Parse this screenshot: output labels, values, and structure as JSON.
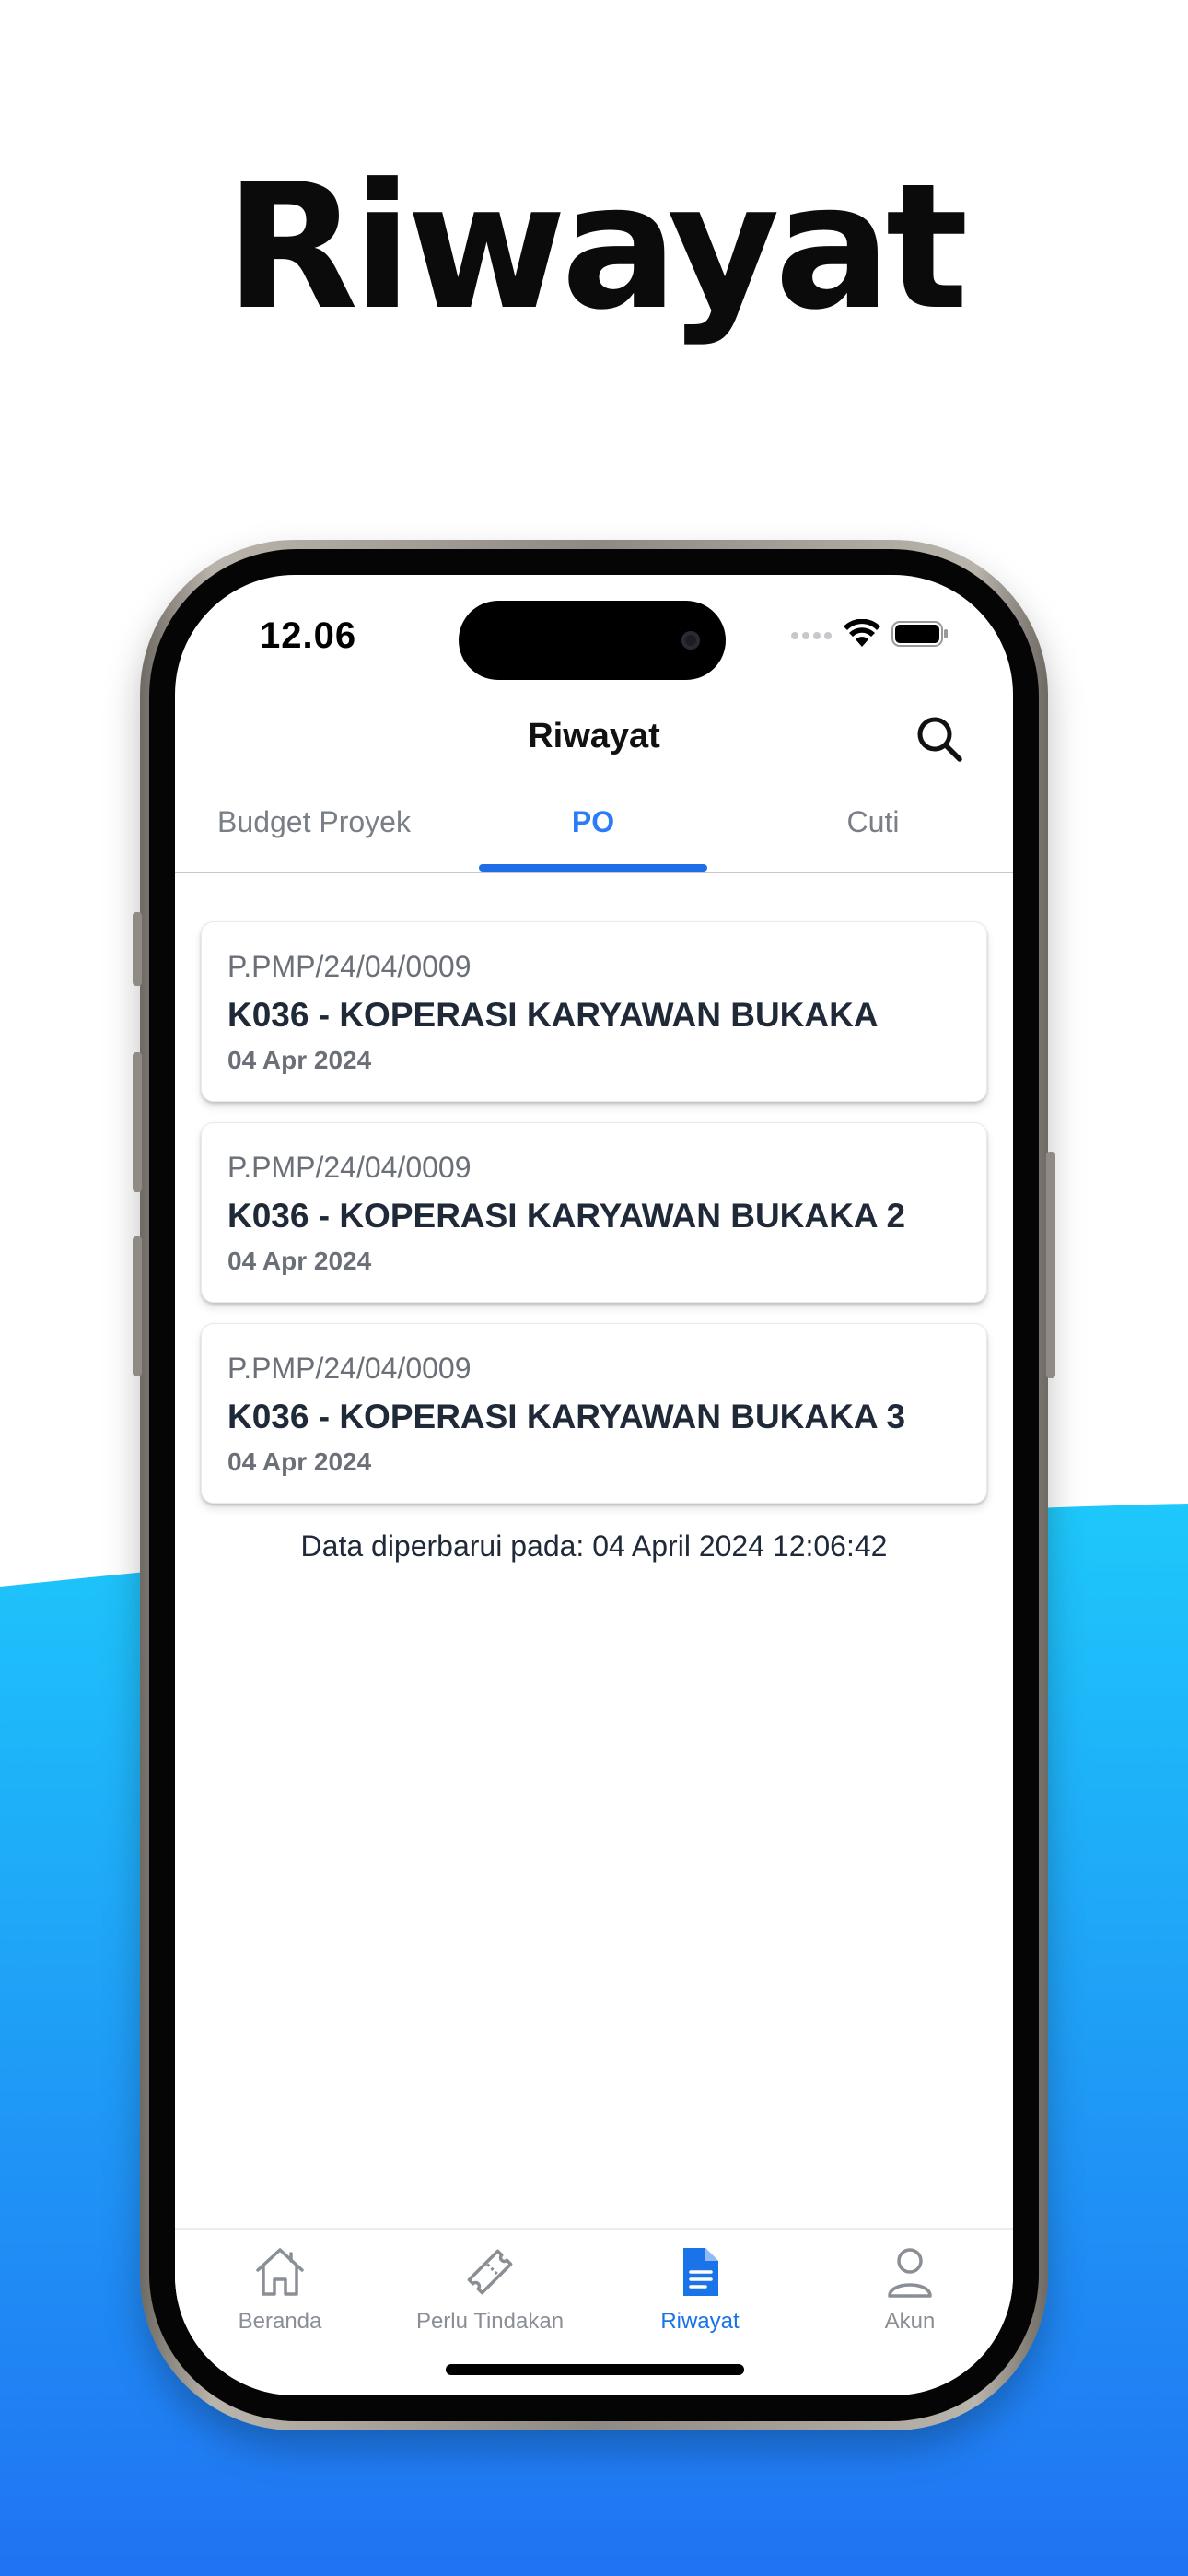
{
  "hero": {
    "title": "Riwayat"
  },
  "status_bar": {
    "time": "12.06"
  },
  "header": {
    "title": "Riwayat"
  },
  "tabs": [
    {
      "label": "Budget Proyek",
      "active": false
    },
    {
      "label": "PO",
      "active": true
    },
    {
      "label": "Cuti",
      "active": false
    }
  ],
  "list": {
    "items": [
      {
        "code": "P.PMP/24/04/0009",
        "name": "K036 - KOPERASI KARYAWAN BUKAKA",
        "date": "04 Apr 2024"
      },
      {
        "code": "P.PMP/24/04/0009",
        "name": "K036 - KOPERASI KARYAWAN BUKAKA 2",
        "date": "04 Apr 2024"
      },
      {
        "code": "P.PMP/24/04/0009",
        "name": "K036 - KOPERASI KARYAWAN BUKAKA 3",
        "date": "04 Apr 2024"
      }
    ],
    "updated_text": "Data diperbarui pada: 04 April 2024 12:06:42"
  },
  "bottom_nav": [
    {
      "label": "Beranda",
      "icon": "home-icon",
      "active": false
    },
    {
      "label": "Perlu Tindakan",
      "icon": "ticket-icon",
      "active": false
    },
    {
      "label": "Riwayat",
      "icon": "document-icon",
      "active": true
    },
    {
      "label": "Akun",
      "icon": "user-icon",
      "active": false
    }
  ],
  "colors": {
    "accent": "#1a73e8",
    "tab_active": "#2b7cf6",
    "background_gradient_top": "#1ec8fb",
    "background_gradient_bottom": "#2073f2"
  }
}
